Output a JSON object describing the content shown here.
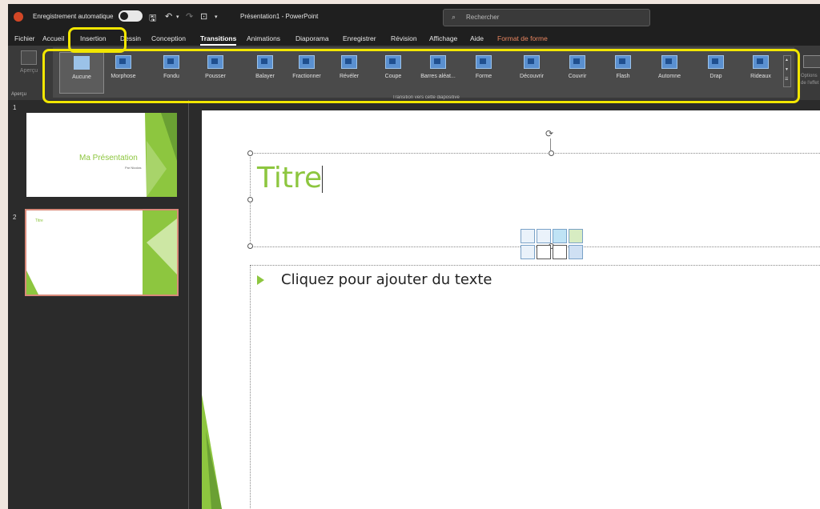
{
  "titlebar": {
    "autosave_label": "Enregistrement automatique",
    "document_title": "Présentation1 - PowerPoint",
    "search_placeholder": "Rechercher"
  },
  "menu": {
    "tabs": [
      "Fichier",
      "Accueil",
      "Insertion",
      "Dessin",
      "Conception",
      "Transitions",
      "Animations",
      "Diaporama",
      "Enregistrer",
      "Révision",
      "Affichage",
      "Aide",
      "Format de forme"
    ],
    "active": "Transitions"
  },
  "ribbon": {
    "preview_label": "Aperçu",
    "preview_group_label": "Aperçu",
    "group_label": "Transition vers cette diapositive",
    "right_label": "Options de l'effet",
    "transitions": [
      "Aucune",
      "Morphose",
      "Fondu",
      "Pousser",
      "Balayer",
      "Fractionner",
      "Révéler",
      "Coupe",
      "Barres aléat...",
      "Forme",
      "Découvrir",
      "Couvrir",
      "Flash",
      "Automne",
      "Drap",
      "Rideaux"
    ],
    "selected": "Aucune"
  },
  "thumbnails": [
    {
      "number": "1",
      "title": "Ma Présentation",
      "subtitle": "Par Nicolas"
    },
    {
      "number": "2",
      "title": "Titre"
    }
  ],
  "slide": {
    "title": "Titre",
    "body": "Cliquez pour ajouter du texte"
  },
  "colors": {
    "accent": "#8dc63f",
    "highlight": "#f2e600",
    "format_tab": "#e8855f"
  }
}
